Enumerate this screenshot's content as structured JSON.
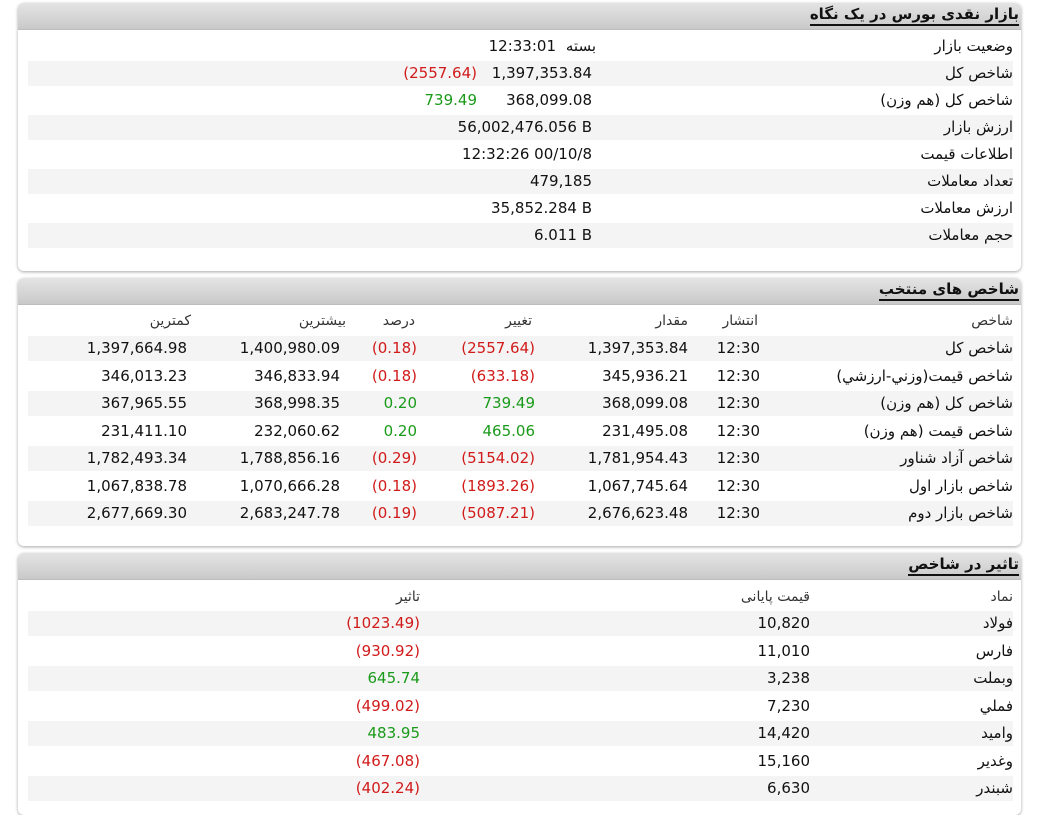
{
  "colors": {
    "negative": "#d11a1a",
    "positive": "#1a9a1a"
  },
  "overview": {
    "title": "بازار نقدی بورس در یک نگاه",
    "rows": [
      {
        "label": "وضعیت بازار",
        "status": "بسته",
        "value": "12:33:01"
      },
      {
        "label": "شاخص کل",
        "value": "1,397,353.84",
        "change": "(2557.64)",
        "change_sign": "negative"
      },
      {
        "label": "شاخص کل (هم وزن)",
        "value": "368,099.08",
        "change": "739.49",
        "change_sign": "positive"
      },
      {
        "label": "ارزش بازار",
        "value": "56,002,476.056 B"
      },
      {
        "label": "اطلاعات قیمت",
        "value": "12:32:26 00/10/8"
      },
      {
        "label": "تعداد معاملات",
        "value": "479,185"
      },
      {
        "label": "ارزش معاملات",
        "value": "35,852.284 B"
      },
      {
        "label": "حجم معاملات",
        "value": "6.011 B"
      }
    ]
  },
  "indices": {
    "title": "شاخص های منتخب",
    "headers": {
      "name": "شاخص",
      "time": "انتشار",
      "value": "مقدار",
      "change": "تغییر",
      "percent": "درصد",
      "high": "بیشترین",
      "low": "کمترین"
    },
    "rows": [
      {
        "name": "شاخص کل",
        "time": "12:30",
        "value": "1,397,353.84",
        "change": "(2557.64)",
        "percent": "(0.18)",
        "high": "1,400,980.09",
        "low": "1,397,664.98",
        "sign": "negative"
      },
      {
        "name": "شاخص قيمت(وزني-ارزشي)",
        "time": "12:30",
        "value": "345,936.21",
        "change": "(633.18)",
        "percent": "(0.18)",
        "high": "346,833.94",
        "low": "346,013.23",
        "sign": "negative"
      },
      {
        "name": "شاخص کل (هم وزن)",
        "time": "12:30",
        "value": "368,099.08",
        "change": "739.49",
        "percent": "0.20",
        "high": "368,998.35",
        "low": "367,965.55",
        "sign": "positive"
      },
      {
        "name": "شاخص قیمت (هم وزن)",
        "time": "12:30",
        "value": "231,495.08",
        "change": "465.06",
        "percent": "0.20",
        "high": "232,060.62",
        "low": "231,411.10",
        "sign": "positive"
      },
      {
        "name": "شاخص آزاد شناور",
        "time": "12:30",
        "value": "1,781,954.43",
        "change": "(5154.02)",
        "percent": "(0.29)",
        "high": "1,788,856.16",
        "low": "1,782,493.34",
        "sign": "negative"
      },
      {
        "name": "شاخص بازار اول",
        "time": "12:30",
        "value": "1,067,745.64",
        "change": "(1893.26)",
        "percent": "(0.18)",
        "high": "1,070,666.28",
        "low": "1,067,838.78",
        "sign": "negative"
      },
      {
        "name": "شاخص بازار دوم",
        "time": "12:30",
        "value": "2,676,623.48",
        "change": "(5087.21)",
        "percent": "(0.19)",
        "high": "2,683,247.78",
        "low": "2,677,669.30",
        "sign": "negative"
      }
    ]
  },
  "impact": {
    "title": "تاثیر در شاخص",
    "headers": {
      "symbol": "نماد",
      "price": "قیمت پایانی",
      "impact": "تاثیر"
    },
    "rows": [
      {
        "symbol": "فولاد",
        "price": "10,820",
        "impact": "(1023.49)",
        "sign": "negative"
      },
      {
        "symbol": "فارس",
        "price": "11,010",
        "impact": "(930.92)",
        "sign": "negative"
      },
      {
        "symbol": "وبملت",
        "price": "3,238",
        "impact": "645.74",
        "sign": "positive"
      },
      {
        "symbol": "فملي",
        "price": "7,230",
        "impact": "(499.02)",
        "sign": "negative"
      },
      {
        "symbol": "واميد",
        "price": "14,420",
        "impact": "483.95",
        "sign": "positive"
      },
      {
        "symbol": "وغدير",
        "price": "15,160",
        "impact": "(467.08)",
        "sign": "negative"
      },
      {
        "symbol": "شبندر",
        "price": "6,630",
        "impact": "(402.24)",
        "sign": "negative"
      }
    ]
  }
}
